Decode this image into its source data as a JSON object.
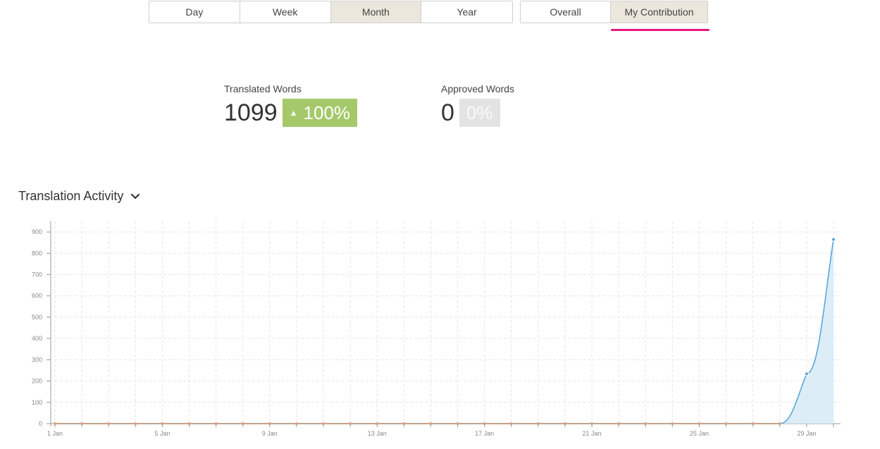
{
  "period_tabs": [
    {
      "label": "Day",
      "active": false
    },
    {
      "label": "Week",
      "active": false
    },
    {
      "label": "Month",
      "active": true
    },
    {
      "label": "Year",
      "active": false
    }
  ],
  "scope_tabs": [
    {
      "label": "Overall",
      "active": false
    },
    {
      "label": "My Contribution",
      "active": true
    }
  ],
  "stats": {
    "translated": {
      "label": "Translated Words",
      "value": "1099",
      "change": "100%"
    },
    "approved": {
      "label": "Approved Words",
      "value": "0",
      "change": "0%"
    }
  },
  "section": {
    "title": "Translation Activity"
  },
  "colors": {
    "accent": "#e5197e",
    "positive": "#a5c96a",
    "line": "#5aa7d6",
    "fill": "#d6eaf7"
  },
  "chart_data": {
    "type": "area",
    "x": [
      "1 Jan",
      "2 Jan",
      "3 Jan",
      "4 Jan",
      "5 Jan",
      "6 Jan",
      "7 Jan",
      "8 Jan",
      "9 Jan",
      "10 Jan",
      "11 Jan",
      "12 Jan",
      "13 Jan",
      "14 Jan",
      "15 Jan",
      "16 Jan",
      "17 Jan",
      "18 Jan",
      "19 Jan",
      "20 Jan",
      "21 Jan",
      "22 Jan",
      "23 Jan",
      "24 Jan",
      "25 Jan",
      "26 Jan",
      "27 Jan",
      "28 Jan",
      "29 Jan",
      "30 Jan"
    ],
    "series": [
      {
        "values": [
          0,
          0,
          0,
          0,
          0,
          0,
          0,
          0,
          0,
          0,
          0,
          0,
          0,
          0,
          0,
          0,
          0,
          0,
          0,
          0,
          0,
          0,
          0,
          0,
          0,
          0,
          0,
          0,
          234,
          865
        ]
      }
    ],
    "x_tick_labels": [
      "1 Jan",
      "5 Jan",
      "9 Jan",
      "13 Jan",
      "17 Jan",
      "21 Jan",
      "25 Jan",
      "29 Jan"
    ],
    "y_ticks": [
      0,
      100,
      200,
      300,
      400,
      500,
      600,
      700,
      800,
      900
    ],
    "ylim": [
      0,
      950
    ],
    "grid": true
  }
}
